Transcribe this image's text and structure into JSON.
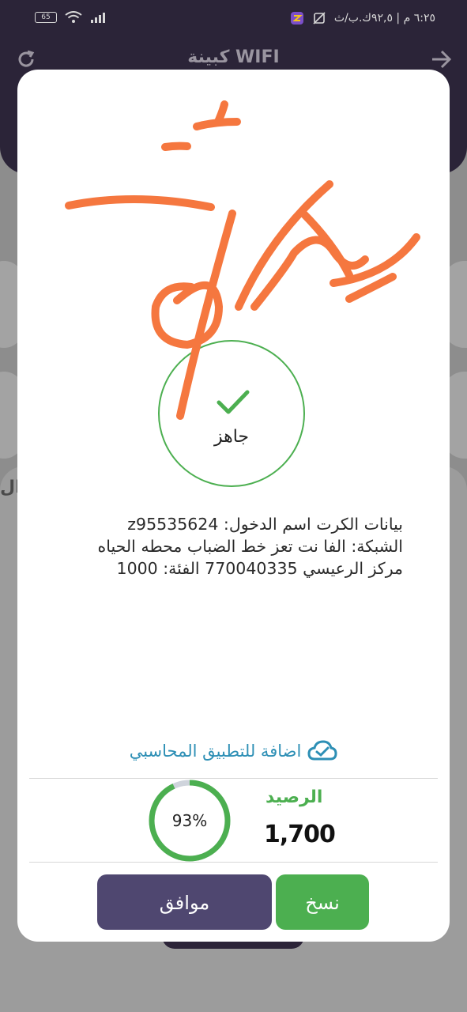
{
  "status_bar": {
    "battery": "65",
    "time_text": "٦:٢٥ م | ٩٢,٥ك.ب/ث"
  },
  "background_app": {
    "title": "كبينة WIFI",
    "partial_heading": "ال"
  },
  "modal": {
    "ready_label": "جاهز",
    "card_info": {
      "line1": "بيانات الكرت اسم الدخول: z95535624",
      "line2": "الشبكة: الفا نت تعز خط الضباب محطه الحياه",
      "line3": "مركز الرعيسي  770040335 الفئة: 1000"
    },
    "accounting_link": "اضافة للتطبيق المحاسبي",
    "progress": {
      "value": 0.93,
      "label": "93%"
    },
    "balance": {
      "title": "الرصيد",
      "value": "1,700"
    },
    "buttons": {
      "ok": "موافق",
      "copy": "نسخ"
    }
  },
  "colors": {
    "accent_green": "#4caf50",
    "primary_purple": "#4f4770",
    "link_blue": "#2d8fb5",
    "signature_orange": "#f5773f"
  },
  "icons": {
    "refresh": "refresh-icon",
    "back": "arrow-back-icon",
    "check": "check-icon",
    "cloud": "cloud-check-icon"
  }
}
